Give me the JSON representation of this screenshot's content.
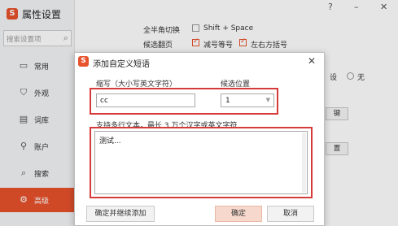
{
  "window": {
    "title": "属性设置",
    "logo_glyph": "S",
    "controls": {
      "help": "?",
      "minimize": "–",
      "close": "✕"
    }
  },
  "search": {
    "placeholder": "搜索设置项"
  },
  "sidebar": {
    "items": [
      {
        "label": "常用",
        "icon": "monitor-icon",
        "glyph": "▭"
      },
      {
        "label": "外观",
        "icon": "shirt-icon",
        "glyph": "⛉"
      },
      {
        "label": "词库",
        "icon": "book-icon",
        "glyph": "▤"
      },
      {
        "label": "账户",
        "icon": "user-icon",
        "glyph": "⚲"
      },
      {
        "label": "搜索",
        "icon": "search-icon",
        "glyph": "⌕"
      },
      {
        "label": "高级",
        "icon": "advanced-icon",
        "glyph": "⚙",
        "active": true
      }
    ]
  },
  "settings": {
    "fullwidth_label": "全半角切换",
    "fullwidth_option": "Shift + Space",
    "page_label": "候选翻页",
    "page_option_1": "减号等号",
    "page_option_2": "左右方括号",
    "radio_none": "无",
    "partial_btn_1": "键",
    "partial_btn_2": "置"
  },
  "dialog": {
    "title": "添加自定义短语",
    "logo_glyph": "S",
    "close_glyph": "✕",
    "abbr_label": "缩写（大小写英文字符）",
    "abbr_value": "cc",
    "position_label": "候选位置",
    "position_value": "1",
    "text_label": "支持多行文本，最长 3 万个汉字或英文字符",
    "text_value": "测试...",
    "buttons": {
      "continue": "确定并继续添加",
      "ok": "确定",
      "cancel": "取消"
    }
  },
  "colors": {
    "accent": "#e8522c",
    "highlight": "#d63b3b",
    "ok_button": "#f6d8cc"
  }
}
